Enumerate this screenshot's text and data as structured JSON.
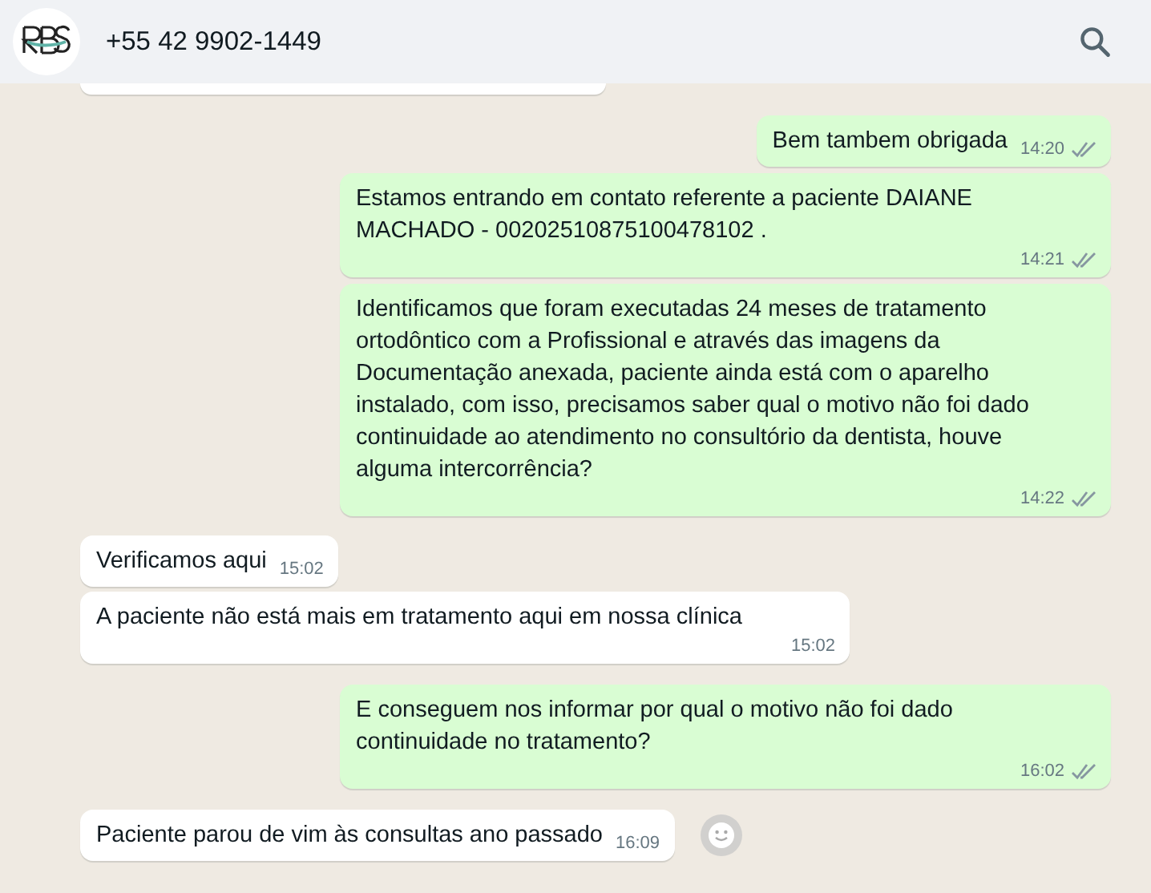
{
  "header": {
    "title": "+55 42 9902-1449"
  },
  "messages": [
    {
      "kind": "outgoing",
      "text": "Bem tambem obrigada",
      "time": "14:20"
    },
    {
      "kind": "outgoing",
      "text": "Estamos entrando em contato referente a paciente DAIANE MACHADO - 00202510875100478102 .",
      "time": "14:21"
    },
    {
      "kind": "outgoing",
      "text": "Identificamos que foram executadas 24 meses de tratamento ortodôntico com a Profissional e através das imagens da Documentação anexada, paciente ainda está com o aparelho instalado, com isso, precisamos saber qual o motivo não foi dado continuidade ao atendimento no consultório da dentista, houve alguma intercorrência?",
      "time": "14:22"
    },
    {
      "kind": "incoming",
      "text": "Verificamos aqui",
      "time": "15:02"
    },
    {
      "kind": "incoming",
      "text": "A paciente não está mais em tratamento aqui em nossa clínica",
      "time": "15:02",
      "time_below": true
    },
    {
      "kind": "outgoing",
      "text": "E conseguem nos informar por qual o motivo não foi dado continuidade no tratamento?",
      "time": "16:02"
    },
    {
      "kind": "incoming",
      "text": "Paciente parou de vim às consultas ano passado",
      "time": "16:09",
      "reaction_button": true
    }
  ]
}
